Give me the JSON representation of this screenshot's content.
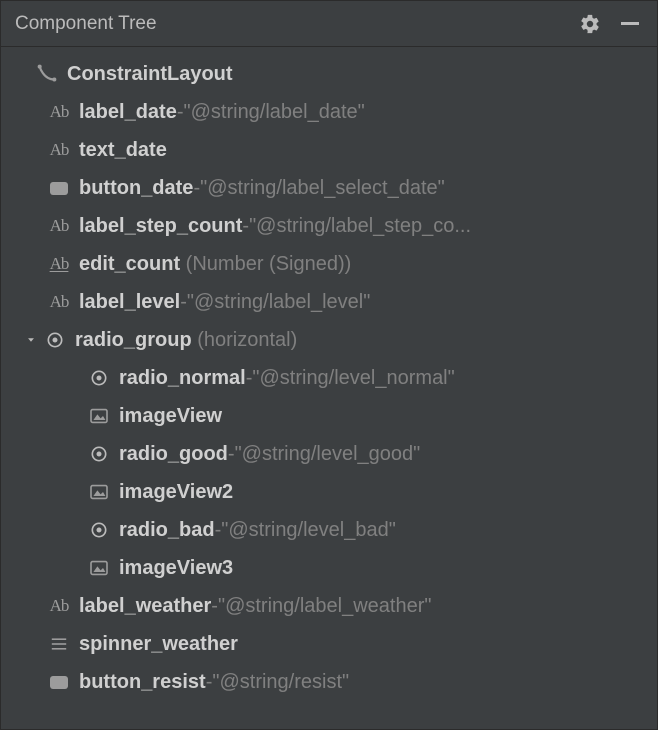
{
  "header": {
    "title": "Component Tree"
  },
  "tree": {
    "root": {
      "label": "ConstraintLayout",
      "children": [
        {
          "id": "label_date",
          "value": "\"@string/label_date\""
        },
        {
          "id": "text_date"
        },
        {
          "id": "button_date",
          "value": "\"@string/label_select_date\""
        },
        {
          "id": "label_step_count",
          "value": "\"@string/label_step_co..."
        },
        {
          "id": "edit_count",
          "paren": "Number (Signed)"
        },
        {
          "id": "label_level",
          "value": "\"@string/label_level\""
        },
        {
          "id": "radio_group",
          "paren": "horizontal",
          "children": [
            {
              "id": "radio_normal",
              "value": "\"@string/level_normal\""
            },
            {
              "id": "imageView"
            },
            {
              "id": "radio_good",
              "value": "\"@string/level_good\""
            },
            {
              "id": "imageView2"
            },
            {
              "id": "radio_bad",
              "value": "\"@string/level_bad\""
            },
            {
              "id": "imageView3"
            }
          ]
        },
        {
          "id": "label_weather",
          "value": "\"@string/label_weather\""
        },
        {
          "id": "spinner_weather"
        },
        {
          "id": "button_resist",
          "value": "\"@string/resist\""
        }
      ]
    }
  }
}
